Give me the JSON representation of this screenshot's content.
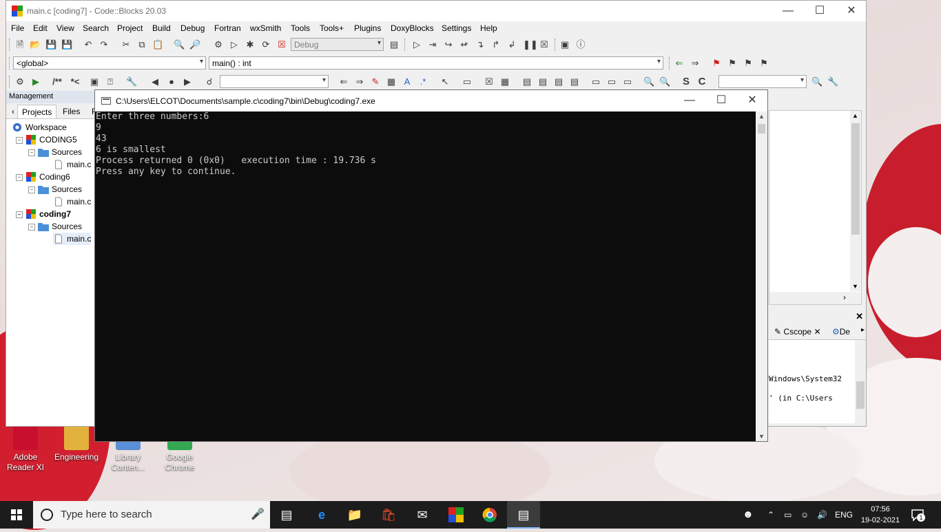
{
  "codeblocks": {
    "title": "main.c [coding7] - Code::Blocks 20.03",
    "menu": [
      "File",
      "Edit",
      "View",
      "Search",
      "Project",
      "Build",
      "Debug",
      "Fortran",
      "wxSmith",
      "Tools",
      "Tools+",
      "Plugins",
      "DoxyBlocks",
      "Settings",
      "Help"
    ],
    "build_target": "Debug",
    "scope_combo": "<global>",
    "function_combo": "main() : int",
    "toolbar3_comment": "/**",
    "toolbar3_comment2": "*<",
    "management": {
      "title": "Management",
      "tabs": [
        "Projects",
        "Files",
        "F"
      ],
      "tree": [
        {
          "label": "Workspace",
          "level": 0,
          "icon": "workspace-icon",
          "bold": false
        },
        {
          "label": "CODING5",
          "level": 1,
          "icon": "project-icon",
          "bold": false
        },
        {
          "label": "Sources",
          "level": 2,
          "icon": "folder-icon",
          "bold": false
        },
        {
          "label": "main.c",
          "level": 3,
          "icon": "file-icon",
          "bold": false
        },
        {
          "label": "Coding6",
          "level": 1,
          "icon": "project-icon",
          "bold": false
        },
        {
          "label": "Sources",
          "level": 2,
          "icon": "folder-icon",
          "bold": false
        },
        {
          "label": "main.c",
          "level": 3,
          "icon": "file-icon",
          "bold": false
        },
        {
          "label": "coding7",
          "level": 1,
          "icon": "project-icon",
          "bold": true
        },
        {
          "label": "Sources",
          "level": 2,
          "icon": "folder-icon",
          "bold": false
        },
        {
          "label": "main.c",
          "level": 3,
          "icon": "file-icon",
          "bold": false
        }
      ]
    },
    "logs": {
      "tab_cscope": "Cscope",
      "tab_debug": "De",
      "line1": "Windows\\System32",
      "line2": "' (in C:\\Users"
    }
  },
  "console": {
    "title": "C:\\Users\\ELCOT\\Documents\\sample.c\\coding7\\bin\\Debug\\coding7.exe",
    "lines": [
      "Enter three numbers:6",
      "9",
      "43",
      "6 is smallest",
      "Process returned 0 (0x0)   execution time : 19.736 s",
      "Press any key to continue."
    ]
  },
  "desktop_icons": [
    {
      "label1": "Adobe",
      "label2": "Reader XI",
      "color": "#c8102e"
    },
    {
      "label1": "Engineering",
      "label2": "",
      "color": "#e3b23c"
    },
    {
      "label1": "Library",
      "label2": "Conten...",
      "color": "#5a8fd8"
    },
    {
      "label1": "Google",
      "label2": "Chrome",
      "color": "#34a853"
    }
  ],
  "taskbar": {
    "search_placeholder": "Type here to search",
    "language": "ENG",
    "time": "07:56",
    "date": "19-02-2021",
    "notification_count": "1"
  }
}
